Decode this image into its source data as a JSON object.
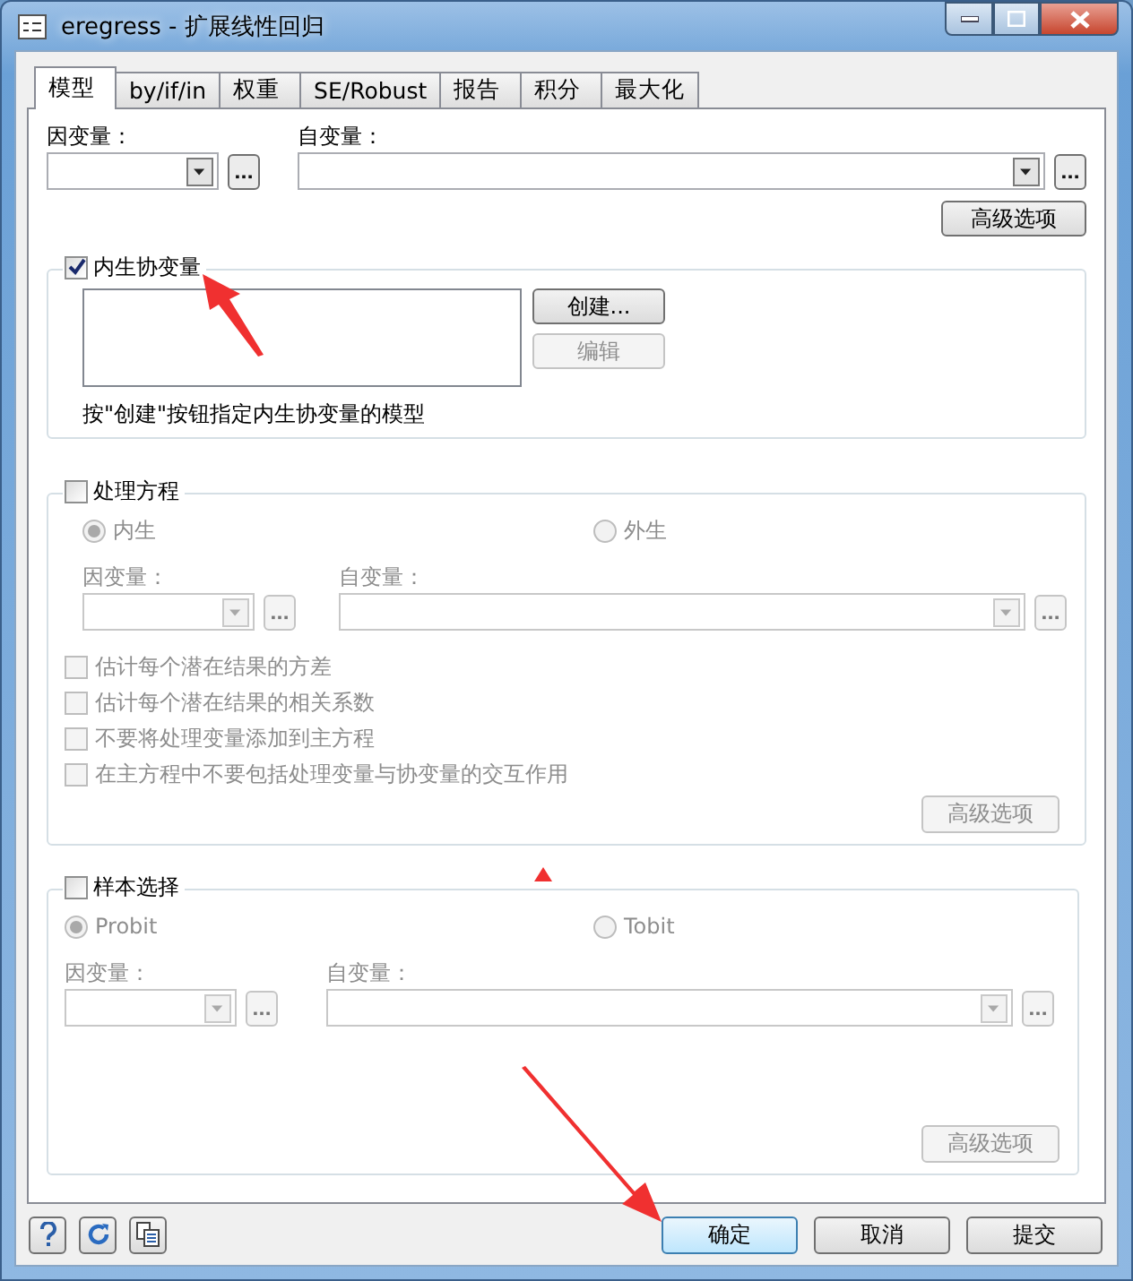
{
  "window": {
    "title": "eregress - 扩展线性回归"
  },
  "tabs": [
    {
      "label": "模型",
      "selected": true
    },
    {
      "label": "by/if/in",
      "selected": false
    },
    {
      "label": "权重",
      "selected": false
    },
    {
      "label": "SE/Robust",
      "selected": false
    },
    {
      "label": "报告",
      "selected": false
    },
    {
      "label": "积分",
      "selected": false
    },
    {
      "label": "最大化",
      "selected": false
    }
  ],
  "model": {
    "depvar_label": "因变量：",
    "indepvar_label": "自变量：",
    "advanced_button": "高级选项",
    "groups": [
      {
        "kind": "endog",
        "title": "内生协变量",
        "checked": true,
        "buttons": [
          {
            "label": "创建...",
            "disabled": false
          },
          {
            "label": "编辑",
            "disabled": true
          }
        ],
        "hint": "按\"创建\"按钮指定内生协变量的模型"
      },
      {
        "kind": "equation",
        "title": "处理方程",
        "checked": false,
        "radios": [
          {
            "label": "内生",
            "selected": true
          },
          {
            "label": "外生",
            "selected": false
          }
        ],
        "depvar_label": "因变量：",
        "indepvar_label": "自变量：",
        "options": [
          {
            "label": "估计每个潜在结果的方差",
            "checked": false
          },
          {
            "label": "估计每个潜在结果的相关系数",
            "checked": false
          },
          {
            "label": "不要将处理变量添加到主方程",
            "checked": false
          },
          {
            "label": "在主方程中不要包括处理变量与协变量的交互作用",
            "checked": false
          }
        ],
        "advanced_button": "高级选项"
      },
      {
        "kind": "equation",
        "title": "样本选择",
        "checked": false,
        "radios": [
          {
            "label": "Probit",
            "selected": true
          },
          {
            "label": "Tobit",
            "selected": false
          }
        ],
        "depvar_label": "因变量：",
        "indepvar_label": "自变量：",
        "advanced_button": "高级选项"
      }
    ]
  },
  "footer": {
    "buttons": [
      {
        "label": "确定",
        "default": true
      },
      {
        "label": "取消",
        "default": false
      },
      {
        "label": "提交",
        "default": false
      }
    ]
  }
}
